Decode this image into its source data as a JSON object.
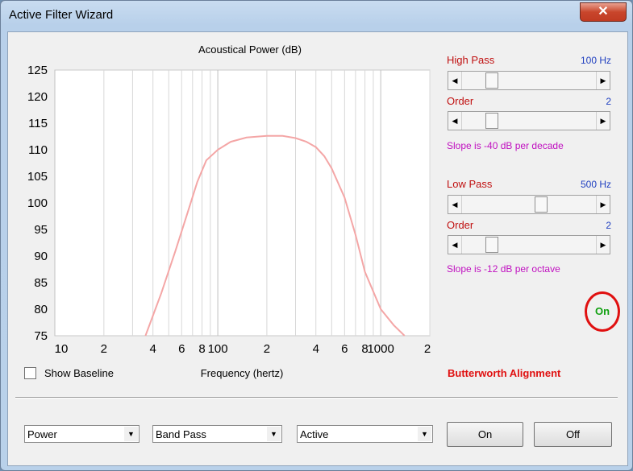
{
  "window": {
    "title": "Active Filter Wizard",
    "close_glyph": "✕"
  },
  "chart": {
    "title": "Acoustical Power (dB)",
    "xlabel": "Frequency (hertz)",
    "y_ticks": [
      "125",
      "120",
      "115",
      "110",
      "105",
      "100",
      "95",
      "90",
      "85",
      "80",
      "75"
    ],
    "x_ticks": [
      "10",
      "2",
      "4",
      "6",
      "8",
      "100",
      "2",
      "4",
      "6",
      "8",
      "1000",
      "2"
    ]
  },
  "chart_data": {
    "type": "line",
    "title": "Acoustical Power (dB)",
    "xlabel": "Frequency (hertz)",
    "ylabel": "",
    "x_scale": "log",
    "xlim": [
      10,
      2000
    ],
    "ylim": [
      75,
      125
    ],
    "grid": true,
    "series": [
      {
        "color": "#f4a6a6",
        "x": [
          36,
          45,
          55,
          65,
          75,
          85,
          100,
          120,
          150,
          200,
          250,
          300,
          350,
          400,
          450,
          500,
          600,
          700,
          800,
          1000,
          1200,
          1400
        ],
        "y": [
          75,
          83,
          91,
          98,
          104,
          108,
          110,
          111.5,
          112.3,
          112.6,
          112.6,
          112.2,
          111.5,
          110.5,
          108.8,
          106.5,
          101,
          94,
          87,
          80,
          77,
          75
        ]
      }
    ]
  },
  "controls": {
    "high_pass": {
      "label": "High Pass",
      "value": "100 Hz",
      "slider_fraction": 0.2
    },
    "high_order": {
      "label": "Order",
      "value": "2",
      "slider_fraction": 0.2
    },
    "high_slope": "Slope is -40 dB per decade",
    "low_pass": {
      "label": "Low Pass",
      "value": "500 Hz",
      "slider_fraction": 0.6
    },
    "low_order": {
      "label": "Order",
      "value": "2",
      "slider_fraction": 0.2
    },
    "low_slope": "Slope is -12 dB per octave",
    "status": "On",
    "alignment": "Butterworth Alignment"
  },
  "baseline": {
    "label": "Show Baseline",
    "checked": false
  },
  "bottom": {
    "combos": [
      "Power",
      "Band Pass",
      "Active"
    ],
    "on_button": "On",
    "off_button": "Off"
  },
  "colors": {
    "curve": "#f4a6a6",
    "label_red": "#c01010",
    "value_blue": "#2040c0",
    "slope_magenta": "#c010c0",
    "status_green": "#10a010"
  }
}
